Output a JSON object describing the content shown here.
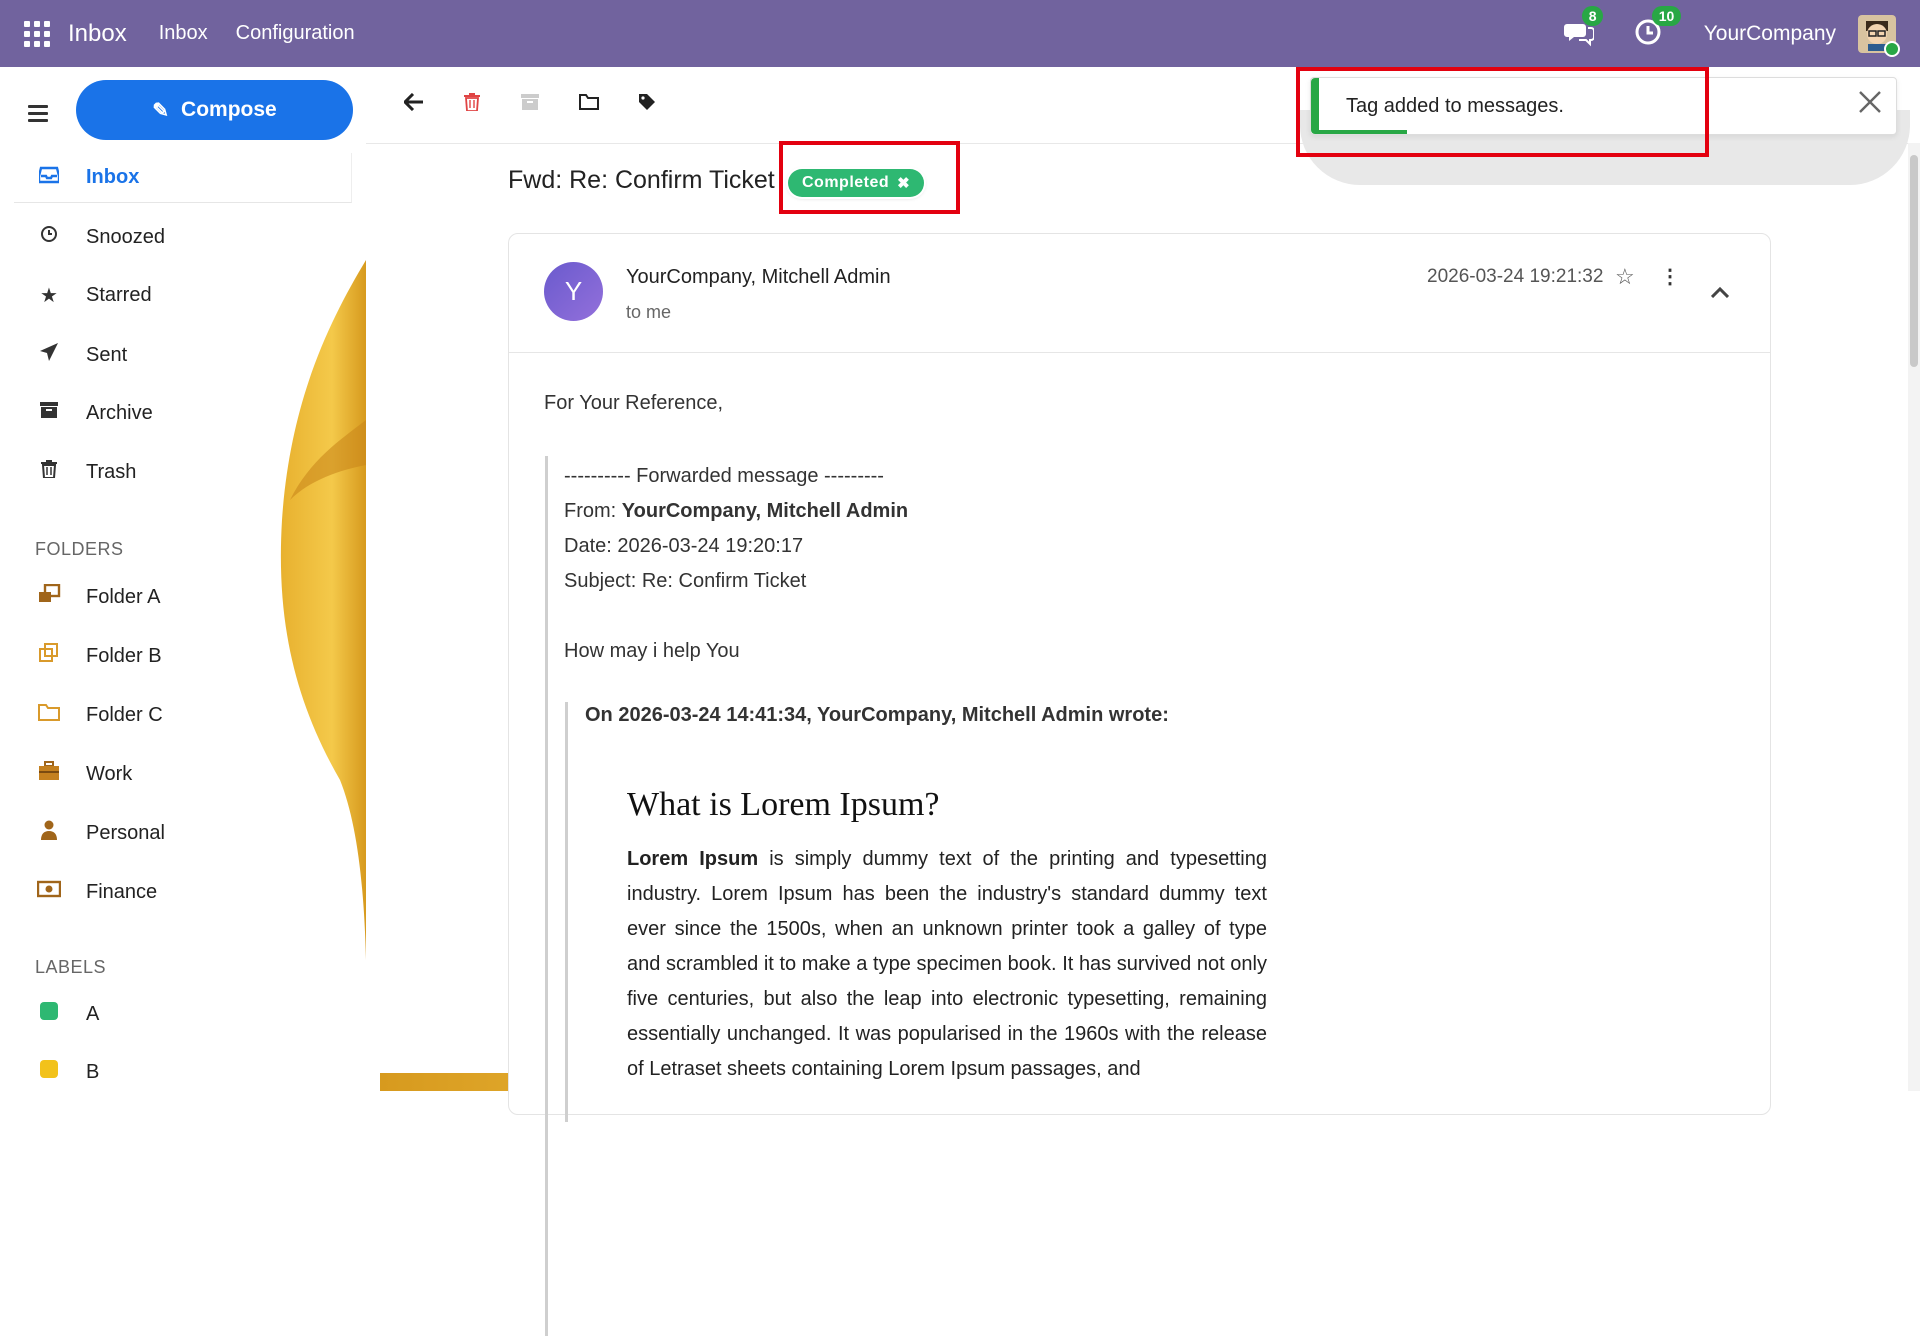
{
  "topbar": {
    "app_title": "Inbox",
    "nav": [
      "Inbox",
      "Configuration"
    ],
    "messages_badge": "8",
    "activity_badge": "10",
    "company": "YourCompany"
  },
  "sidebar": {
    "compose_label": "Compose",
    "items": [
      {
        "label": "Inbox",
        "icon": "inbox-icon"
      },
      {
        "label": "Snoozed",
        "icon": "clock-icon"
      },
      {
        "label": "Starred",
        "icon": "star-icon"
      },
      {
        "label": "Sent",
        "icon": "send-icon"
      },
      {
        "label": "Archive",
        "icon": "archive-icon"
      },
      {
        "label": "Trash",
        "icon": "trash-icon"
      }
    ],
    "folders_heading": "FOLDERS",
    "folders": [
      {
        "label": "Folder A",
        "icon": "folders-icon"
      },
      {
        "label": "Folder B",
        "icon": "copy-folder-icon"
      },
      {
        "label": "Folder C",
        "icon": "folder-icon"
      },
      {
        "label": "Work",
        "icon": "briefcase-icon"
      },
      {
        "label": "Personal",
        "icon": "user-icon"
      },
      {
        "label": "Finance",
        "icon": "money-icon"
      }
    ],
    "labels_heading": "LABELS",
    "labels": [
      {
        "label": "A",
        "color": "#2eb872"
      },
      {
        "label": "B",
        "color": "#f2c21b"
      }
    ]
  },
  "toast": {
    "message": "Tag added to messages.",
    "progress": 0.15
  },
  "email": {
    "subject": "Fwd: Re: Confirm Ticket",
    "tag": "Completed",
    "avatar_letter": "Y",
    "sender": "YourCompany, Mitchell Admin",
    "recipient": "to me",
    "datetime": "2026-03-24 19:21:32",
    "greeting": "For Your Reference,",
    "fwd_header": "---------- Forwarded message ---------",
    "from_label": "From: ",
    "from_value": "YourCompany, Mitchell Admin",
    "date_line": "Date: 2026-03-24 19:20:17",
    "subject_line": "Subject: Re: Confirm Ticket",
    "help_line": "How may i help You",
    "wrote_line": "On 2026-03-24 14:41:34, YourCompany, Mitchell Admin wrote:",
    "lorem_heading": "What is Lorem Ipsum?",
    "lorem_bold": "Lorem Ipsum",
    "lorem_body": " is simply dummy text of the printing and typesetting industry. Lorem Ipsum has been the industry's standard dummy text ever since the 1500s, when an unknown printer took a galley of type and scrambled it to make a type specimen book. It has survived not only five centuries, but also the leap into electronic typesetting, remaining essentially unchanged. It was popularised in the 1960s with the release of Letraset sheets containing Lorem Ipsum passages, and"
  }
}
